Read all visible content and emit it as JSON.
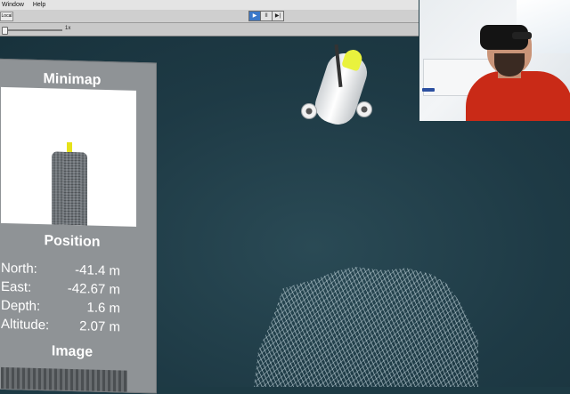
{
  "editor": {
    "menu": [
      "Window",
      "Help"
    ],
    "toolbar_left_button": "Local",
    "play_controls": [
      "▶",
      "II",
      "▶|"
    ],
    "slider_value": "1x"
  },
  "panel": {
    "minimap_title": "Minimap",
    "position_title": "Position",
    "position": [
      {
        "label": "North:",
        "value": "-41.4 m"
      },
      {
        "label": "East:",
        "value": "-42.67 m"
      },
      {
        "label": "Depth:",
        "value": "1.6 m"
      },
      {
        "label": "Altitude:",
        "value": "2.07 m"
      }
    ],
    "image_title": "Image"
  },
  "colors": {
    "scene_bg": "#1e3a45",
    "rov_accent": "#e9f23d",
    "shirt": "#c92a17"
  }
}
